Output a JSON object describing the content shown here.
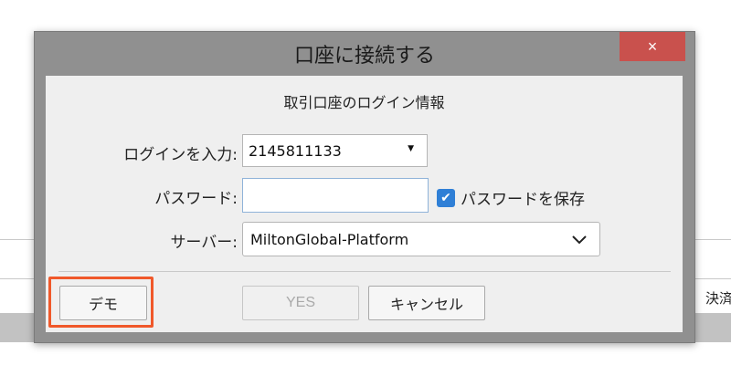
{
  "background": {
    "partial_text": "決済",
    "band_color": "#c2c2c2"
  },
  "dialog": {
    "title": "口座に接続する",
    "close_label": "×",
    "close_color": "#c9514d",
    "subtitle": "取引口座のログイン情報",
    "login": {
      "label": "ログインを入力:",
      "value": "2145811133"
    },
    "password": {
      "label": "パスワード:",
      "value": "",
      "save_checked": true,
      "save_label": "パスワードを保存"
    },
    "server": {
      "label": "サーバー:",
      "value": "MiltonGlobal-Platform"
    },
    "buttons": {
      "demo": "デモ",
      "yes": "YES",
      "cancel": "キャンセル"
    },
    "highlight_color": "#f0582a"
  }
}
